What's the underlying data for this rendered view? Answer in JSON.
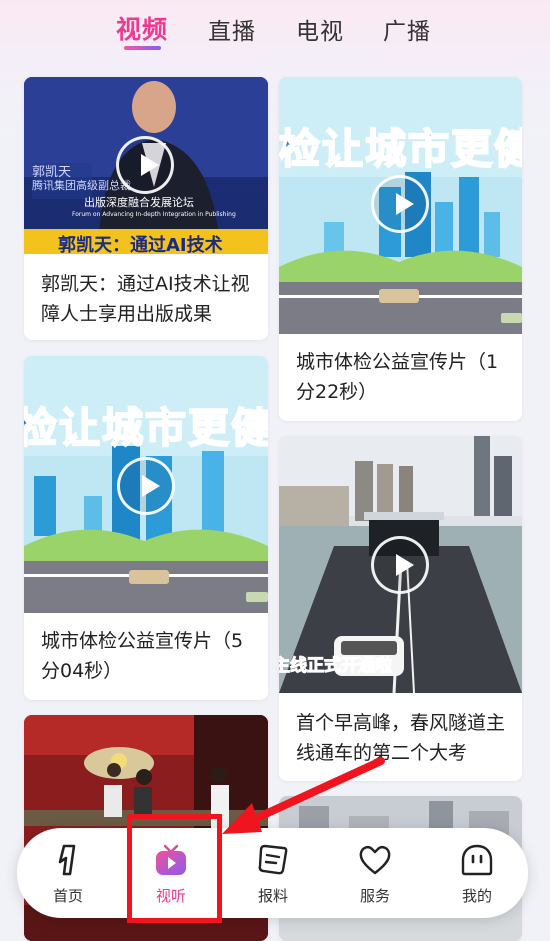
{
  "tabs": [
    {
      "label": "视频",
      "active": true
    },
    {
      "label": "直播",
      "active": false
    },
    {
      "label": "电视",
      "active": false
    },
    {
      "label": "广播",
      "active": false
    }
  ],
  "colors": {
    "accent": "#ec3b8f",
    "annotation": "#f0141e"
  },
  "cards": [
    {
      "title": "郭凯天：通过AI技术让视障人士享用出版成果",
      "thumb_captions": {
        "speaker_name": "郭凯天",
        "speaker_role": "腾讯集团高级副总裁",
        "forum": "出版深度融合发展论坛",
        "forum_en": "Forum on Advancing In-depth Integration in Publishing",
        "banner": "郭凯天：通过AI技术"
      }
    },
    {
      "title": "城市体检公益宣传片（1分22秒）",
      "thumb_captions": {
        "banner": "检让城市更健"
      }
    },
    {
      "title": "城市体检公益宣传片（5分04秒）",
      "thumb_captions": {
        "banner": "检让城市更健"
      }
    },
    {
      "title": "首个早高峰，春风隧道主线通车的第二个大考",
      "thumb_captions": {
        "banner": "主线正式开通啦"
      }
    }
  ],
  "nav": [
    {
      "label": "首页",
      "icon": "home-icon",
      "active": false
    },
    {
      "label": "视听",
      "icon": "tv-play-icon",
      "active": true
    },
    {
      "label": "报料",
      "icon": "report-icon",
      "active": false
    },
    {
      "label": "服务",
      "icon": "heart-icon",
      "active": false
    },
    {
      "label": "我的",
      "icon": "profile-icon",
      "active": false
    }
  ]
}
